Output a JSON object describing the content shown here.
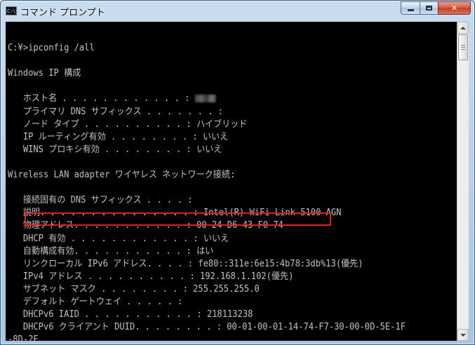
{
  "window": {
    "title": "コマンド プロンプト",
    "icon_text": "C:\\"
  },
  "console": {
    "lines": [
      "",
      "C:¥>ipconfig /all",
      "",
      "Windows IP 構成",
      "",
      "   ホスト名 . . . . . . . . . . . . :",
      "   プライマリ DNS サフィックス . . . . . . . :",
      "   ノード タイプ . . . . . . . . . . : ハイブリッド",
      "   IP ルーティング有効 . . . . . . . . : いいえ",
      "   WINS プロキシ有効 . . . . . . . . : いいえ",
      "",
      "Wireless LAN adapter ワイヤレス ネットワーク接続:",
      "",
      "   接続固有の DNS サフィックス . . . . :",
      "   説明. . . . . . . . . . . . . . . : Intel(R) WiFi Link 5100 AGN",
      "   物理アドレス. . . . . . . . . . . : 00-24-D6-43-F0-74",
      "   DHCP 有効 . . . . . . . . . . . . : いいえ",
      "   自動構成有効. . . . . . . . . . . : はい",
      "   リンクローカル IPv6 アドレス. . . . : fe80::311e:6e15:4b78:3db%13(優先)",
      "   IPv4 アドレス . . . . . . . . . . : 192.168.1.102(優先)",
      "   サブネット マスク . . . . . . . . : 255.255.255.0",
      "   デフォルト ゲートウェイ . . . . . :",
      "   DHCPv6 IAID . . . . . . . . . . . : 218113238",
      "   DHCPv6 クライアント DUID. . . . . . . . : 00-01-00-01-14-74-F7-30-00-0D-5E-1F",
      "-8D-2E"
    ],
    "redacted_line_index": 5
  },
  "colors": {
    "console_bg": "#000000",
    "console_text": "#c0c0c0",
    "highlight": "#e0201a"
  }
}
